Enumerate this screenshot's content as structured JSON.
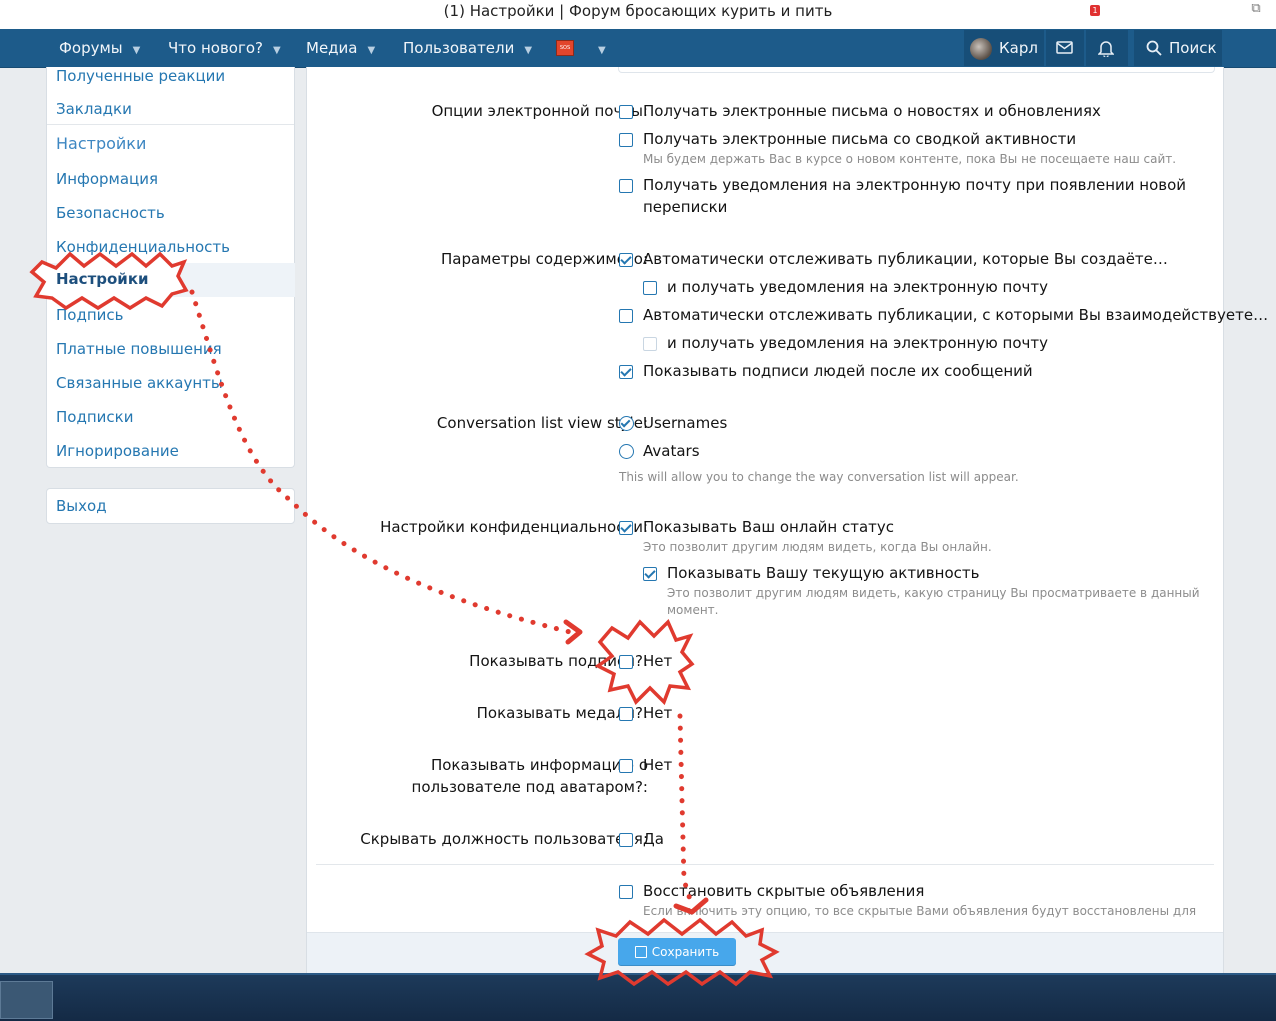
{
  "window": {
    "title": "(1) Настройки | Форум бросающих курить и пить"
  },
  "nav": {
    "items": [
      "Форумы",
      "Что нового?",
      "Медиа",
      "Пользователи"
    ],
    "flag_text": "SOS",
    "user_name": "Карл",
    "alerts_count": "1",
    "search_label": "Поиск"
  },
  "sidebar": {
    "items": [
      "Полученные реакции",
      "Закладки",
      "Настройки",
      "Информация",
      "Безопасность",
      "Конфиденциальность",
      "Настройки",
      "Подпись",
      "Платные повышения",
      "Связанные аккаунты",
      "Подписки",
      "Игнорирование"
    ],
    "logout": "Выход"
  },
  "form": {
    "email": {
      "label": "Опции электронной почты:",
      "options": [
        "Получать электронные письма о новостях и обновлениях",
        "Получать электронные письма со сводкой активности",
        "Получать уведомления на электронную почту при появлении новой",
        "переписки"
      ],
      "hint": "Мы будем держать Вас в курсе о новом контенте, пока Вы не посещаете наш сайт."
    },
    "content": {
      "label": "Параметры содержимого:",
      "options": [
        "Автоматически отслеживать публикации, которые Вы создаёте…",
        "и получать уведомления на электронную почту",
        "Автоматически отслеживать публикации, с которыми Вы взаимодействуете…",
        "и получать уведомления на электронную почту",
        "Показывать подписи людей после их сообщений"
      ]
    },
    "conversation": {
      "label": "Conversation list view style:",
      "options": [
        "Usernames",
        "Avatars"
      ],
      "hint": "This will allow you to change the way conversation list will appear."
    },
    "privacy": {
      "label": "Настройки конфиденциальности:",
      "online": "Показывать Ваш онлайн статус",
      "online_hint": "Это позволит другим людям видеть, когда Вы онлайн.",
      "activity": "Показывать Вашу текущую активность",
      "activity_hint_1": "Это позволит другим людям видеть, какую страницу Вы просматриваете в данный",
      "activity_hint_2": "момент."
    },
    "signatures": {
      "label": "Показывать подписи?:",
      "value": "Нет"
    },
    "medals": {
      "label": "Показывать медали?:",
      "value": "Нет"
    },
    "userinfo": {
      "label_1": "Показывать информацию о",
      "label_2": "пользователе под аватаром?:",
      "value": "Нет"
    },
    "usertitle": {
      "label": "Скрывать должность пользователя:",
      "value": "Да"
    },
    "restore": {
      "option": "Восстановить скрытые объявления",
      "hint": "Если включить эту опцию, то все скрытые Вами объявления будут восстановлены для"
    },
    "save_label": "Сохранить"
  },
  "annotation": {
    "highlight_label": "Настройки"
  },
  "colors": {
    "nav": "#1d5b8a",
    "link": "#2577b1",
    "button": "#47a7eb",
    "annotation": "#e03a2f"
  }
}
